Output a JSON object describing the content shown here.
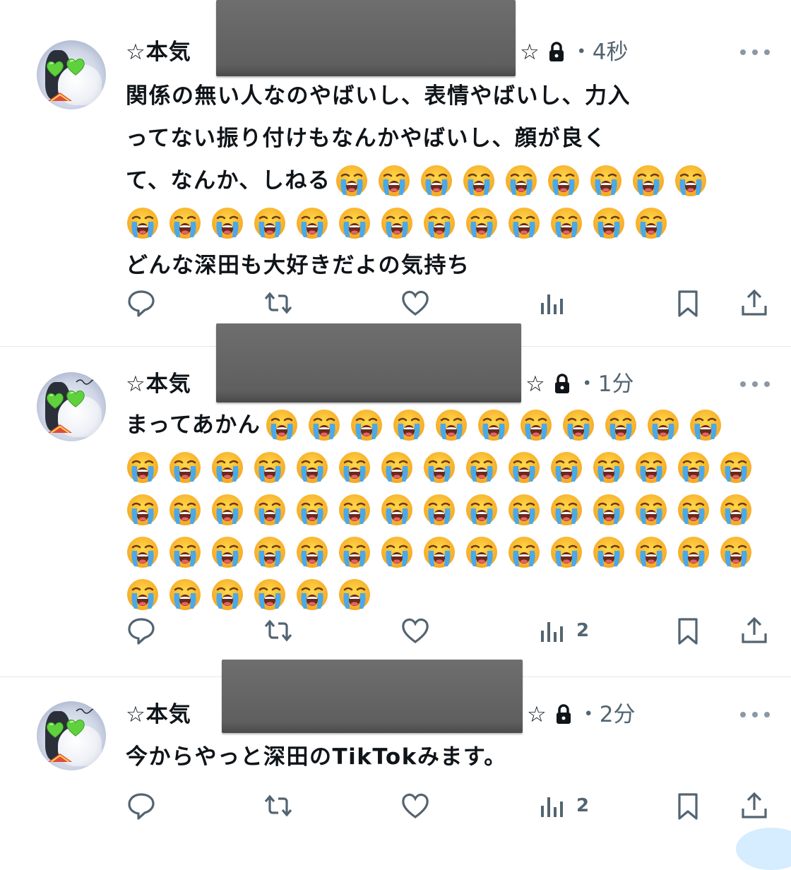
{
  "tweets": [
    {
      "name_prefix": "☆本気",
      "name_suffix_star": "☆",
      "time": "・4秒",
      "text_lines": [
        "関係の無い人なのやばいし、表情やばいし、力入",
        "ってない振り付けもなんかやばいし、顔が良く"
      ],
      "line3_text": "て、なんか、しねる",
      "line3_emojis": 9,
      "line4_emojis": 13,
      "line5_text": "どんな深田も大好きだよの気持ち",
      "views": ""
    },
    {
      "name_prefix": "☆本気",
      "name_suffix_star": "☆",
      "time": "・1分",
      "line1_text": "まってあかん",
      "line1_emojis": 11,
      "full_emoji_rows": 3,
      "per_row": 15,
      "last_row_emojis": 6,
      "views": "2"
    },
    {
      "name_prefix": "☆本気",
      "name_suffix_star": "☆",
      "time": "・2分",
      "text": "今からやっと深田のTikTokみます。",
      "views": "2"
    }
  ],
  "icons": {
    "reply": "reply-icon",
    "retweet": "retweet-icon",
    "like": "like-icon",
    "views": "views-icon",
    "bookmark": "bookmark-icon",
    "share": "share-icon",
    "emoji": "loudly-crying-face-emoji"
  },
  "colors": {
    "text": "#0f1419",
    "secondary": "#536471",
    "divider": "#e4e8eb"
  }
}
